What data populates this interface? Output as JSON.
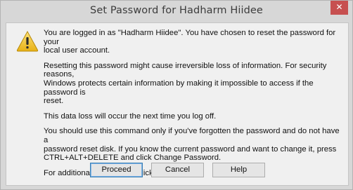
{
  "window": {
    "title": "Set Password for Hadharm Hiidee",
    "close_glyph": "✕"
  },
  "dialog": {
    "icon": "warning-triangle-icon",
    "paragraphs": [
      "You are logged in as \"Hadharm Hiidee\". You have chosen to reset the password for your\nlocal user account.",
      "Resetting this password might cause irreversible loss of information. For security reasons,\nWindows protects certain information by making it impossible to access if the password is\nreset.",
      "This data loss will occur the next time you log off.",
      "You should use this command only if you've forgotten the password and do not have a\npassword reset disk. If you know the current password and want to change it, press\nCTRL+ALT+DELETE and click Change Password.",
      "For additional information, click Help."
    ]
  },
  "buttons": {
    "proceed": "Proceed",
    "cancel": "Cancel",
    "help": "Help"
  },
  "colors": {
    "close_button": "#c75050",
    "default_button_border": "#3c7fb1",
    "warning_fill": "#f2c432"
  }
}
